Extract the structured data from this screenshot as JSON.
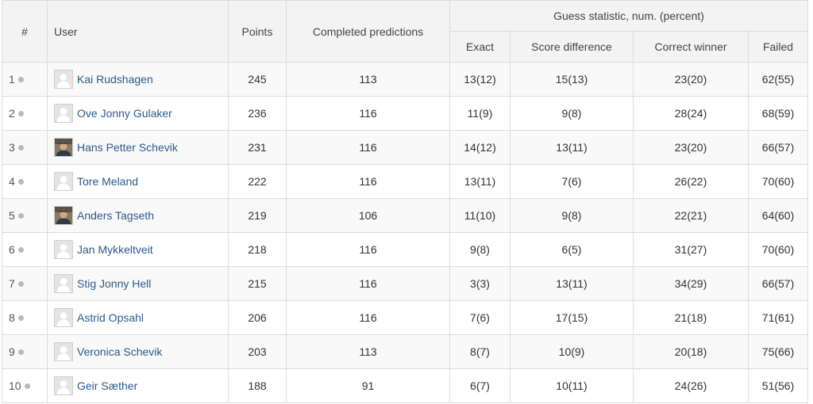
{
  "headers": {
    "rank": "#",
    "user": "User",
    "points": "Points",
    "completed": "Completed predictions",
    "group": "Guess statistic, num. (percent)",
    "exact": "Exact",
    "score_difference": "Score difference",
    "correct_winner": "Correct winner",
    "failed": "Failed"
  },
  "colors": {
    "link": "#2b5a8d",
    "header_bg": "#f3f3f3",
    "stripe_bg": "#f9f9f9",
    "border": "#dcdcdc",
    "status_dot": "#b9b9b9"
  },
  "rows": [
    {
      "rank": "1",
      "avatar": "placeholder-avatar-icon",
      "name": "Kai Rudshagen",
      "points": "245",
      "completed": "113",
      "exact": "13(12)",
      "score_difference": "15(13)",
      "correct_winner": "23(20)",
      "failed": "62(55)"
    },
    {
      "rank": "2",
      "avatar": "placeholder-avatar-icon",
      "name": "Ove Jonny Gulaker",
      "points": "236",
      "completed": "116",
      "exact": "11(9)",
      "score_difference": "9(8)",
      "correct_winner": "28(24)",
      "failed": "68(59)"
    },
    {
      "rank": "3",
      "avatar": "photo-avatar",
      "name": "Hans Petter Schevik",
      "points": "231",
      "completed": "116",
      "exact": "14(12)",
      "score_difference": "13(11)",
      "correct_winner": "23(20)",
      "failed": "66(57)"
    },
    {
      "rank": "4",
      "avatar": "placeholder-avatar-icon",
      "name": "Tore Meland",
      "points": "222",
      "completed": "116",
      "exact": "13(11)",
      "score_difference": "7(6)",
      "correct_winner": "26(22)",
      "failed": "70(60)"
    },
    {
      "rank": "5",
      "avatar": "photo-avatar",
      "name": "Anders Tagseth",
      "points": "219",
      "completed": "106",
      "exact": "11(10)",
      "score_difference": "9(8)",
      "correct_winner": "22(21)",
      "failed": "64(60)"
    },
    {
      "rank": "6",
      "avatar": "placeholder-avatar-icon",
      "name": "Jan Mykkeltveit",
      "points": "218",
      "completed": "116",
      "exact": "9(8)",
      "score_difference": "6(5)",
      "correct_winner": "31(27)",
      "failed": "70(60)"
    },
    {
      "rank": "7",
      "avatar": "placeholder-avatar-icon",
      "name": "Stig Jonny Hell",
      "points": "215",
      "completed": "116",
      "exact": "3(3)",
      "score_difference": "13(11)",
      "correct_winner": "34(29)",
      "failed": "66(57)"
    },
    {
      "rank": "8",
      "avatar": "placeholder-avatar-icon",
      "name": "Astrid Opsahl",
      "points": "206",
      "completed": "116",
      "exact": "7(6)",
      "score_difference": "17(15)",
      "correct_winner": "21(18)",
      "failed": "71(61)"
    },
    {
      "rank": "9",
      "avatar": "placeholder-avatar-icon",
      "name": "Veronica Schevik",
      "points": "203",
      "completed": "113",
      "exact": "8(7)",
      "score_difference": "10(9)",
      "correct_winner": "20(18)",
      "failed": "75(66)"
    },
    {
      "rank": "10",
      "avatar": "placeholder-avatar-icon",
      "name": "Geir Sæther",
      "points": "188",
      "completed": "91",
      "exact": "6(7)",
      "score_difference": "10(11)",
      "correct_winner": "24(26)",
      "failed": "51(56)"
    }
  ]
}
